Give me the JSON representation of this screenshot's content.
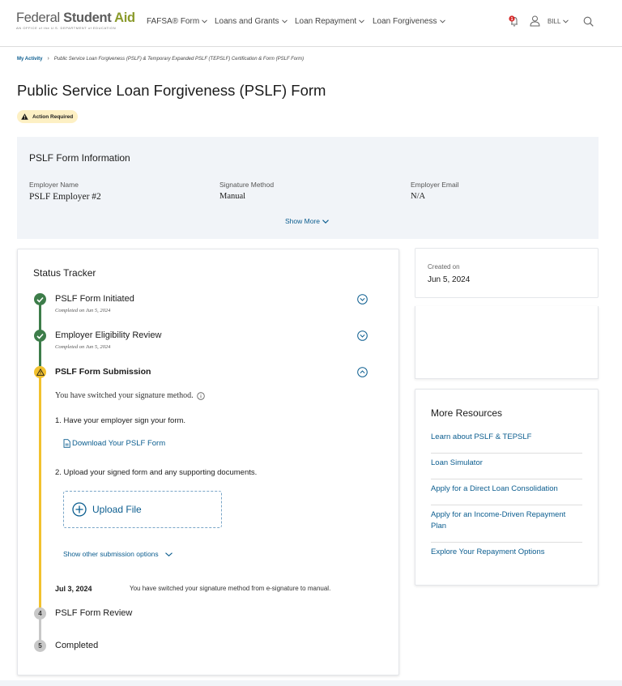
{
  "header": {
    "logo": {
      "part1": "Federal ",
      "part2": "Student ",
      "part3": "Aid",
      "subtitle": "AN OFFICE of the U.S. DEPARTMENT of EDUCATION"
    },
    "nav": [
      {
        "label": "FAFSA® Form"
      },
      {
        "label": "Loans and Grants"
      },
      {
        "label": "Loan Repayment"
      },
      {
        "label": "Loan Forgiveness"
      }
    ],
    "notification_count": "1",
    "user": "BILL",
    "icons": {
      "bell": "bell-icon",
      "user": "user-icon",
      "search": "search-icon"
    }
  },
  "breadcrumb": {
    "home": "My Activity",
    "current": "Public Service Loan Forgiveness (PSLF) & Temporary Expanded PSLF (TEPSLF) Certification & Form (PSLF Form)"
  },
  "page": {
    "title": "Public Service Loan Forgiveness (PSLF) Form",
    "badge": "Action Required"
  },
  "info": {
    "title": "PSLF Form Information",
    "fields": [
      {
        "label": "Employer Name",
        "value": "PSLF Employer #2"
      },
      {
        "label": "Signature Method",
        "value": "Manual"
      },
      {
        "label": "Employer Email",
        "value": "N/A"
      }
    ],
    "show_more": "Show More"
  },
  "tracker": {
    "title": "Status Tracker",
    "steps": [
      {
        "title": "PSLF Form Initiated",
        "sub": "Completed on Jun 5, 2024",
        "status": "complete"
      },
      {
        "title": "Employer Eligibility Review",
        "sub": "Completed on Jun 5, 2024",
        "status": "complete"
      },
      {
        "title": "PSLF Form Submission",
        "status": "action"
      },
      {
        "number": "4",
        "title": "PSLF Form Review",
        "status": "pending"
      },
      {
        "number": "5",
        "title": "Completed",
        "status": "pending"
      }
    ],
    "submission": {
      "switched_note": "You have switched your signature method.",
      "instruction1": "1. Have your employer sign your form.",
      "download_label": "Download Your PSLF Form",
      "instruction2": "2. Upload your signed form and any supporting documents.",
      "upload_label": "Upload File",
      "other_options": "Show other submission options"
    },
    "history": {
      "date": "Jul 3, 2024",
      "text": "You have switched your signature method from e-signature to manual."
    }
  },
  "created": {
    "label": "Created on",
    "value": "Jun 5, 2024"
  },
  "resources": {
    "title": "More Resources",
    "links": [
      "Learn about PSLF & TEPSLF",
      "Loan Simulator",
      "Apply for a Direct Loan Consolidation",
      "Apply for an Income-Driven Repayment Plan",
      "Explore Your Repayment Options"
    ]
  },
  "colors": {
    "link": "#0b5d8f",
    "complete": "#3d7d4a",
    "action": "#f2c12e",
    "pending": "#c8c8c8",
    "badge_bg": "#fdf0c4",
    "panel_bg": "#f1f4f8",
    "logo_green": "#8a9a2b"
  }
}
